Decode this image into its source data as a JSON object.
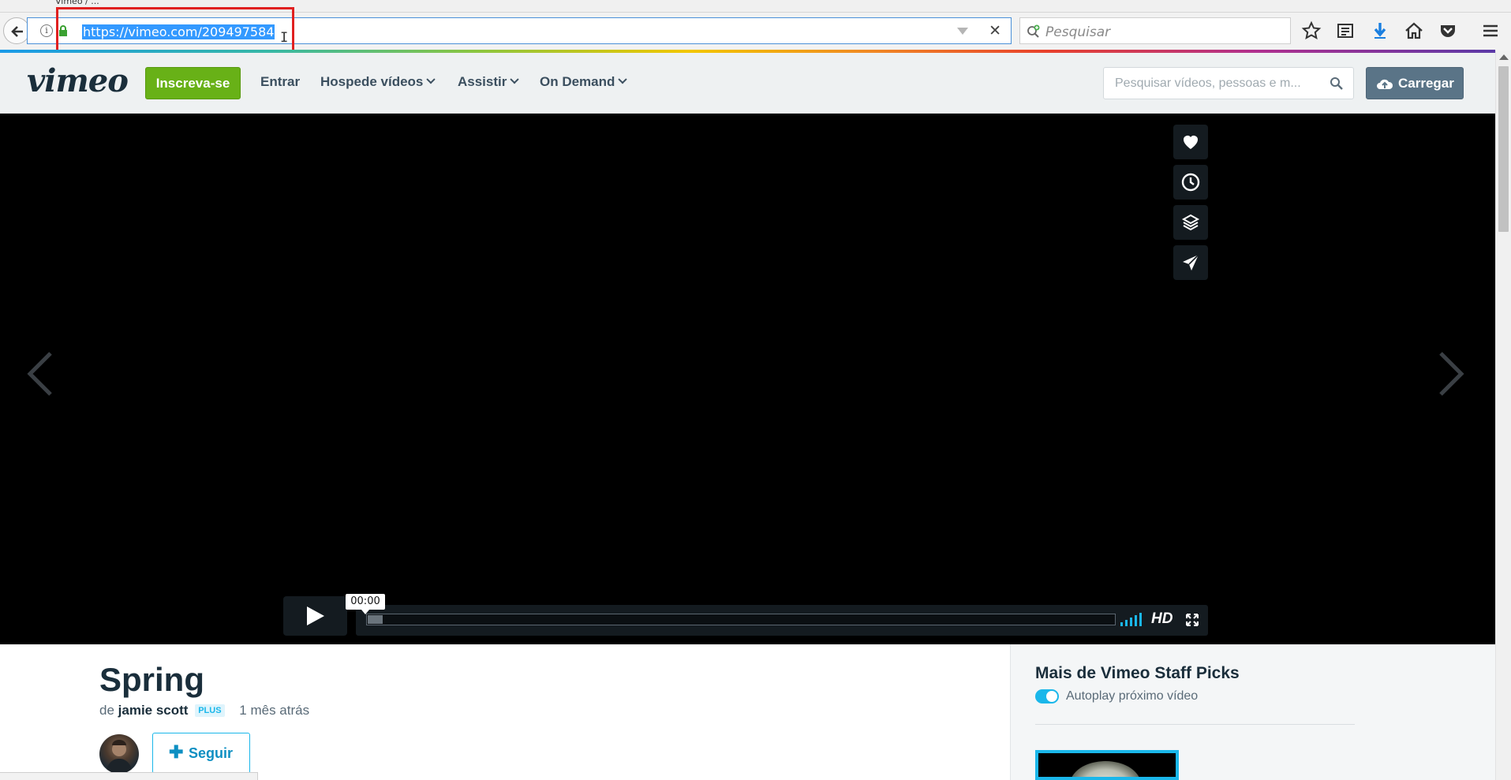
{
  "browser": {
    "tab_title": "Vimeo / ...",
    "url": "https://vimeo.com/209497584",
    "search_placeholder": "Pesquisar",
    "icons": [
      "back-icon",
      "info-icon",
      "lock-icon",
      "dropdown-icon",
      "stop-icon",
      "search-icon",
      "star-icon",
      "reading-list-icon",
      "download-icon",
      "home-icon",
      "pocket-icon",
      "menu-icon"
    ]
  },
  "header": {
    "logo": "vimeo",
    "signup_label": "Inscreva-se",
    "nav": {
      "login": "Entrar",
      "host": "Hospede vídeos",
      "watch": "Assistir",
      "on_demand": "On Demand"
    },
    "search_placeholder": "Pesquisar vídeos, pessoas e m...",
    "upload_label": "Carregar"
  },
  "player": {
    "time": "00:00",
    "hd_label": "HD",
    "progress": 0,
    "side_actions": [
      "heart-icon",
      "clock-icon",
      "layers-icon",
      "send-icon"
    ]
  },
  "video": {
    "title": "Spring",
    "by_prefix": "de",
    "author": "jamie scott",
    "author_badge": "PLUS",
    "uploaded": "1 mês atrás",
    "follow_label": "Seguir"
  },
  "sidebar": {
    "title": "Mais de Vimeo Staff Picks",
    "autoplay_label": "Autoplay próximo vídeo",
    "autoplay_on": true
  },
  "colors": {
    "accent": "#1ab7ea",
    "signup_green": "#68b117",
    "upload_gray": "#5a7487",
    "annotation_red": "#e02020"
  }
}
